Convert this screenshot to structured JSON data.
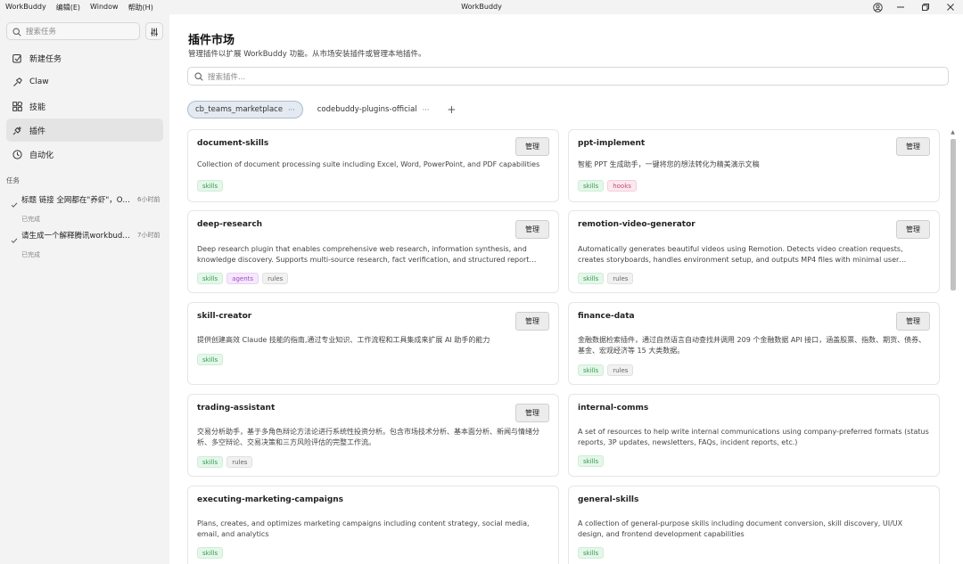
{
  "titlebar": {
    "menus": [
      "WorkBuddy",
      "编辑(E)",
      "Window",
      "帮助(H)"
    ],
    "title": "WorkBuddy"
  },
  "sidebar": {
    "search_placeholder": "搜索任务",
    "nav": [
      {
        "label": "新建任务",
        "icon": "edit-icon"
      },
      {
        "label": "Claw",
        "icon": "claw-icon"
      },
      {
        "label": "技能",
        "icon": "skills-icon"
      },
      {
        "label": "插件",
        "icon": "plugin-icon",
        "active": true
      },
      {
        "label": "自动化",
        "icon": "clock-icon"
      }
    ],
    "tasks_heading": "任务",
    "tasks": [
      {
        "title": "标题 链接 全网都在\"养虾\"，Ope...",
        "time": "6小时前",
        "status": "已完成"
      },
      {
        "title": "请生成一个解释腾讯workbuddy...",
        "time": "7小时前",
        "status": "已完成"
      }
    ]
  },
  "main": {
    "title": "插件市场",
    "subtitle": "管理插件以扩展 WorkBuddy 功能。从市场安装插件或管理本地插件。",
    "search_placeholder": "搜索插件...",
    "tabs": [
      {
        "label": "cb_teams_marketplace",
        "active": true
      },
      {
        "label": "codebuddy-plugins-official",
        "active": false
      }
    ],
    "manage_label": "管理",
    "plugins": [
      {
        "name": "document-skills",
        "desc": "Collection of document processing suite including Excel, Word, PowerPoint, and PDF capabilities",
        "tags": [
          "skills"
        ],
        "manage": true
      },
      {
        "name": "ppt-implement",
        "desc": "智能 PPT 生成助手，一键将您的想法转化为精美演示文稿",
        "tags": [
          "skills",
          "hooks"
        ],
        "manage": true
      },
      {
        "name": "deep-research",
        "desc": "Deep research plugin that enables comprehensive web research, information synthesis, and knowledge discovery. Supports multi-source research, fact verification, and structured report generation.",
        "tags": [
          "skills",
          "agents",
          "rules"
        ],
        "manage": true
      },
      {
        "name": "remotion-video-generator",
        "desc": "Automatically generates beautiful videos using Remotion. Detects video creation requests, creates storyboards, handles environment setup, and outputs MP4 files with minimal user intervention. Supports iterative refinement.",
        "tags": [
          "skills",
          "rules"
        ],
        "manage": true
      },
      {
        "name": "skill-creator",
        "desc": "提供创建高效 Claude 技能的指南,通过专业知识、工作流程和工具集成来扩展 AI 助手的能力",
        "tags": [
          "skills"
        ],
        "manage": true
      },
      {
        "name": "finance-data",
        "desc": "金融数据检索插件，通过自然语言自动查找并调用 209 个金融数据 API 接口，涵盖股票、指数、期货、债券、基金、宏观经济等 15 大类数据。",
        "tags": [
          "skills",
          "rules"
        ],
        "manage": true
      },
      {
        "name": "trading-assistant",
        "desc": "交易分析助手，基于多角色辩论方法论进行系统性投资分析。包含市场技术分析、基本面分析、新闻与情绪分析、多空辩论、交易决策和三方风险评估的完整工作流。",
        "tags": [
          "skills",
          "rules"
        ],
        "manage": true
      },
      {
        "name": "internal-comms",
        "desc": "A set of resources to help write internal communications using company-preferred formats (status reports, 3P updates, newsletters, FAQs, incident reports, etc.)",
        "tags": [
          "skills"
        ],
        "manage": false
      },
      {
        "name": "executing-marketing-campaigns",
        "desc": "Plans, creates, and optimizes marketing campaigns including content strategy, social media, email, and analytics",
        "tags": [
          "skills"
        ],
        "manage": false
      },
      {
        "name": "general-skills",
        "desc": "A collection of general-purpose skills including document conversion, skill discovery, UI/UX design, and frontend development capabilities",
        "tags": [
          "skills"
        ],
        "manage": false
      }
    ]
  }
}
